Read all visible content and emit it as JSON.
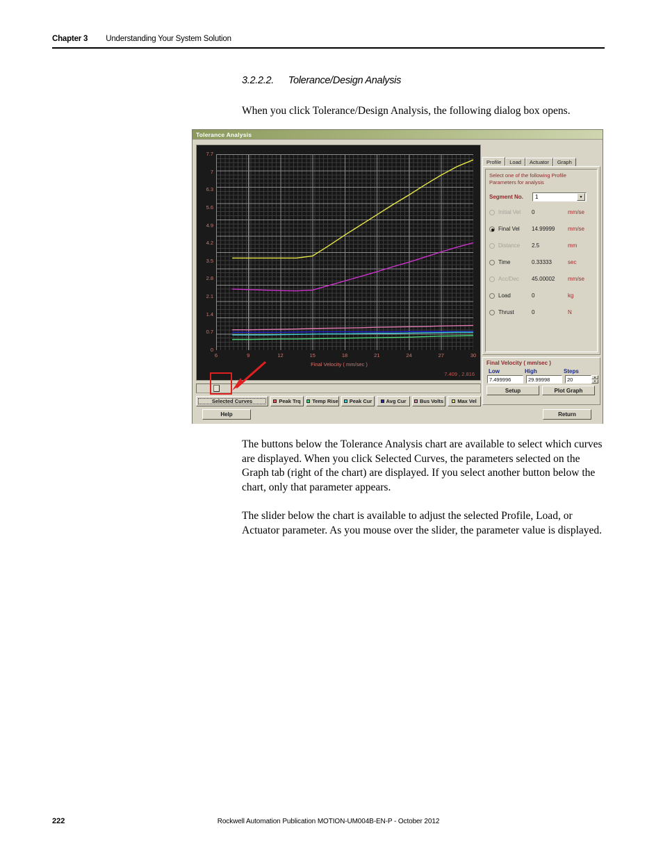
{
  "header": {
    "chapter": "Chapter 3",
    "title": "Understanding Your System Solution"
  },
  "section": {
    "number": "3.2.2.2.",
    "title": "Tolerance/Design Analysis"
  },
  "paragraphs": {
    "intro": "When you click Tolerance/Design Analysis, the following dialog box opens.",
    "body1": "The buttons below the Tolerance Analysis chart are available to select which curves are displayed. When you click Selected Curves, the parameters selected on the Graph tab (right of the chart) are displayed. If you select another button below the chart, only that parameter appears.",
    "body2": "The slider below the chart is available to adjust the selected Profile, Load, or Actuator parameter. As you mouse over the slider, the parameter value is displayed."
  },
  "dialog": {
    "title": "Tolerance Analysis",
    "tabs": [
      {
        "label": "Profile",
        "active": true
      },
      {
        "label": "Load",
        "active": false
      },
      {
        "label": "Actuator",
        "active": false
      },
      {
        "label": "Graph",
        "active": false
      }
    ],
    "parameters": {
      "instruction": "Select one of the following Profile Parameters for analysis",
      "segment_label": "Segment No.",
      "segment_value": "1",
      "rows": [
        {
          "name": "Initial Vel",
          "value": "0",
          "unit": "mm/se",
          "selected": false,
          "enabled": false
        },
        {
          "name": "Final Vel",
          "value": "14.99999",
          "unit": "mm/se",
          "selected": true,
          "enabled": true
        },
        {
          "name": "Distance",
          "value": "2.5",
          "unit": "mm",
          "selected": false,
          "enabled": false
        },
        {
          "name": "Time",
          "value": "0.33333",
          "unit": "sec",
          "selected": false,
          "enabled": true
        },
        {
          "name": "Acc/Dec",
          "value": "45.00002",
          "unit": "mm/se",
          "selected": false,
          "enabled": false
        },
        {
          "name": "Load",
          "value": "0",
          "unit": "kg",
          "selected": false,
          "enabled": true
        },
        {
          "name": "Thrust",
          "value": "0",
          "unit": "N",
          "selected": false,
          "enabled": true
        }
      ]
    },
    "final_velocity": {
      "title": "Final Velocity ( mm/sec )",
      "low_label": "Low",
      "high_label": "High",
      "steps_label": "Steps",
      "low_value": "7.499996",
      "high_value": "29.99998",
      "steps_value": "20",
      "setup_label": "Setup",
      "plot_label": "Plot Graph"
    },
    "curve_buttons": {
      "selected_curves_label": "Selected Curves",
      "items": [
        {
          "label": "Peak Trq",
          "color": "#e05a6a"
        },
        {
          "label": "Temp Rise",
          "color": "#4fd37a"
        },
        {
          "label": "Peak Cur",
          "color": "#3fd0d8"
        },
        {
          "label": "Avg Cur",
          "color": "#2222cc"
        },
        {
          "label": "Bus Volts",
          "color": "#e07ab0"
        },
        {
          "label": "Max Vel",
          "color": "#e8e84a"
        }
      ]
    },
    "help_label": "Help",
    "return_label": "Return",
    "coord_readout": "7.409 , 2.816"
  },
  "chart_data": {
    "type": "line",
    "title": "",
    "xlabel": "Final Velocity ( mm/sec )",
    "ylabel": "",
    "xlim": [
      6,
      30
    ],
    "ylim": [
      0,
      7.7
    ],
    "xticks": [
      6,
      9,
      12,
      15,
      18,
      21,
      24,
      27,
      30
    ],
    "yticks": [
      0,
      0.7,
      1.4,
      2.1,
      2.8,
      3.5,
      4.2,
      4.9,
      5.6,
      6.3,
      7,
      7.7
    ],
    "grid": true,
    "legend": "below-chart-buttons",
    "background": "#161616",
    "x": [
      7.5,
      9,
      10.5,
      12,
      13.5,
      15,
      16.5,
      18,
      19.5,
      21,
      22.5,
      24,
      25.5,
      27,
      28.5,
      30
    ],
    "series": [
      {
        "name": "Max Vel",
        "color": "#e8e84a",
        "values": [
          3.62,
          3.62,
          3.62,
          3.62,
          3.62,
          3.7,
          4.1,
          4.52,
          4.92,
          5.32,
          5.72,
          6.1,
          6.5,
          6.88,
          7.22,
          7.48
        ]
      },
      {
        "name": "Peak Trq",
        "color": "#cc33cc",
        "values": [
          2.4,
          2.38,
          2.36,
          2.34,
          2.33,
          2.36,
          2.54,
          2.72,
          2.9,
          3.08,
          3.28,
          3.46,
          3.66,
          3.86,
          4.05,
          4.22
        ]
      },
      {
        "name": "Bus Volts",
        "color": "#e07ab0",
        "values": [
          0.8,
          0.8,
          0.81,
          0.82,
          0.83,
          0.85,
          0.86,
          0.87,
          0.88,
          0.9,
          0.91,
          0.92,
          0.93,
          0.95,
          0.96,
          0.97
        ]
      },
      {
        "name": "Avg Cur",
        "color": "#2222cc",
        "values": [
          0.7,
          0.7,
          0.7,
          0.7,
          0.71,
          0.72,
          0.72,
          0.72,
          0.72,
          0.72,
          0.72,
          0.73,
          0.73,
          0.73,
          0.73,
          0.73
        ]
      },
      {
        "name": "Peak Cur",
        "color": "#3fd0d8",
        "values": [
          0.6,
          0.6,
          0.6,
          0.61,
          0.62,
          0.63,
          0.64,
          0.64,
          0.65,
          0.66,
          0.66,
          0.67,
          0.68,
          0.69,
          0.7,
          0.7
        ]
      },
      {
        "name": "Temp Rise",
        "color": "#4fd37a",
        "values": [
          0.42,
          0.42,
          0.43,
          0.44,
          0.44,
          0.45,
          0.46,
          0.47,
          0.48,
          0.49,
          0.5,
          0.51,
          0.53,
          0.55,
          0.56,
          0.57
        ]
      }
    ]
  },
  "footer": {
    "page": "222",
    "text": "Rockwell Automation Publication MOTION-UM004B-EN-P - October 2012"
  }
}
